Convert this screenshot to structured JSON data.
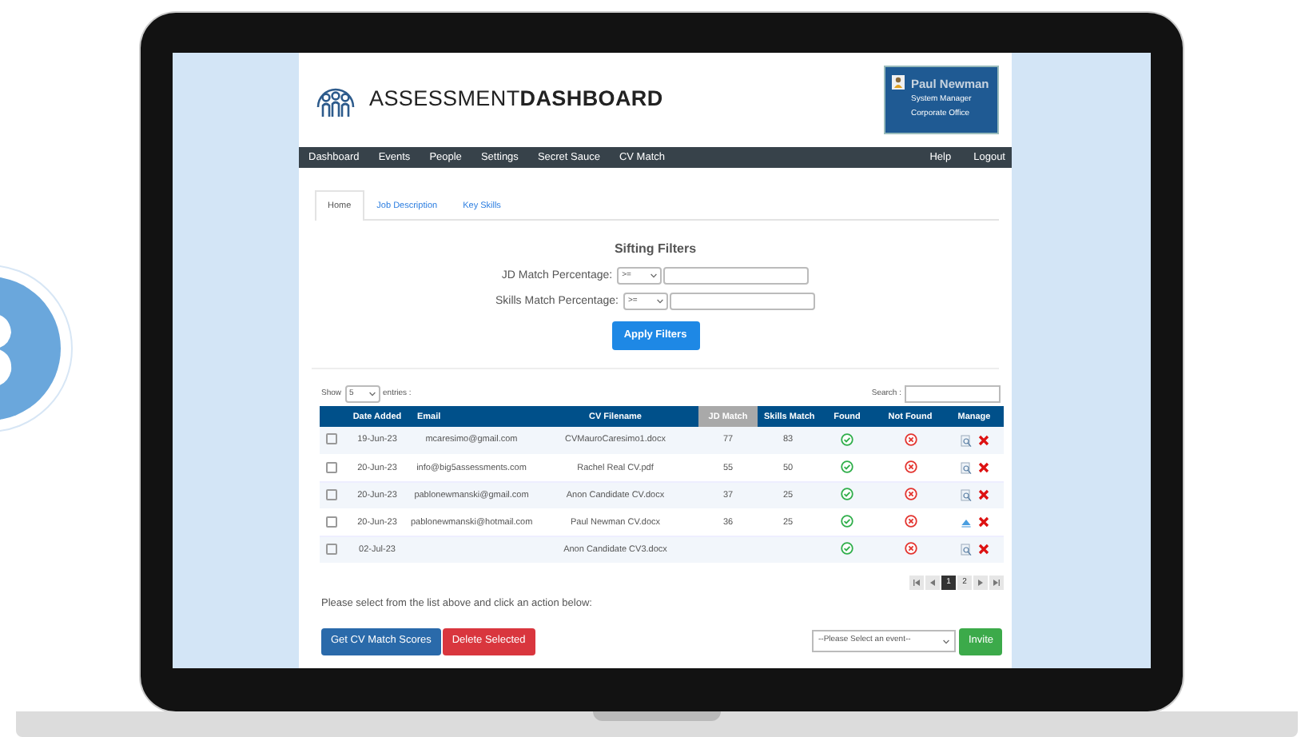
{
  "logo": {
    "text_light": "ASSESSMENT",
    "text_bold": "DASHBOARD"
  },
  "user": {
    "name": "Paul Newman",
    "role": "System Manager",
    "office": "Corporate Office"
  },
  "nav": {
    "left": [
      "Dashboard",
      "Events",
      "People",
      "Settings",
      "Secret Sauce",
      "CV Match"
    ],
    "right": [
      "Help",
      "Logout"
    ]
  },
  "tabs": [
    {
      "label": "Home",
      "selected": true
    },
    {
      "label": "Job Description",
      "selected": false
    },
    {
      "label": "Key Skills",
      "selected": false
    }
  ],
  "filters": {
    "title": "Sifting Filters",
    "rows": [
      {
        "label": "JD Match Percentage:",
        "operator": ">="
      },
      {
        "label": "Skills Match Percentage:",
        "operator": ">="
      }
    ],
    "apply": "Apply Filters"
  },
  "table_controls": {
    "show": "Show",
    "page_size": "5",
    "entries": "entries :",
    "search": "Search :"
  },
  "table": {
    "columns": [
      {
        "label": "Date Added",
        "sorted": false
      },
      {
        "label": "Email",
        "sorted": false
      },
      {
        "label": "CV Filename",
        "sorted": false
      },
      {
        "label": "JD Match",
        "sorted": true
      },
      {
        "label": "Skills Match",
        "sorted": false
      },
      {
        "label": "Found",
        "sorted": false
      },
      {
        "label": "Not Found",
        "sorted": false
      },
      {
        "label": "Manage",
        "sorted": false
      }
    ],
    "rows": [
      {
        "checked": false,
        "date": "19-Jun-23",
        "email": "mcaresimo@gmail.com",
        "cv": "CVMauroCaresimo1.docx",
        "jd": "77",
        "skills": "83",
        "kind": "document"
      },
      {
        "checked": false,
        "date": "20-Jun-23",
        "email": "info@big5assessments.com",
        "cv": "Rachel Real CV.pdf",
        "jd": "55",
        "skills": "50",
        "kind": "document"
      },
      {
        "checked": false,
        "date": "20-Jun-23",
        "email": "pablonewmanski@gmail.com",
        "cv": "Anon Candidate CV.docx",
        "jd": "37",
        "skills": "25",
        "kind": "document"
      },
      {
        "checked": false,
        "date": "20-Jun-23",
        "email": "pablonewmanski@hotmail.com",
        "cv": "Paul Newman CV.docx",
        "jd": "36",
        "skills": "25",
        "kind": "upload"
      },
      {
        "checked": false,
        "date": "02-Jul-23",
        "cv": "Anon Candidate CV3.docx",
        "kind": "document"
      }
    ]
  },
  "pagination": {
    "pages": [
      {
        "label": "1",
        "selected": true
      },
      {
        "label": "2",
        "selected": false
      }
    ]
  },
  "instruction": "Please select from the list above and click an action below:",
  "actions": {
    "get_scores": "Get CV Match Scores",
    "delete": "Delete Selected",
    "event_select": "--Please Select an event--",
    "invite": "Invite"
  }
}
